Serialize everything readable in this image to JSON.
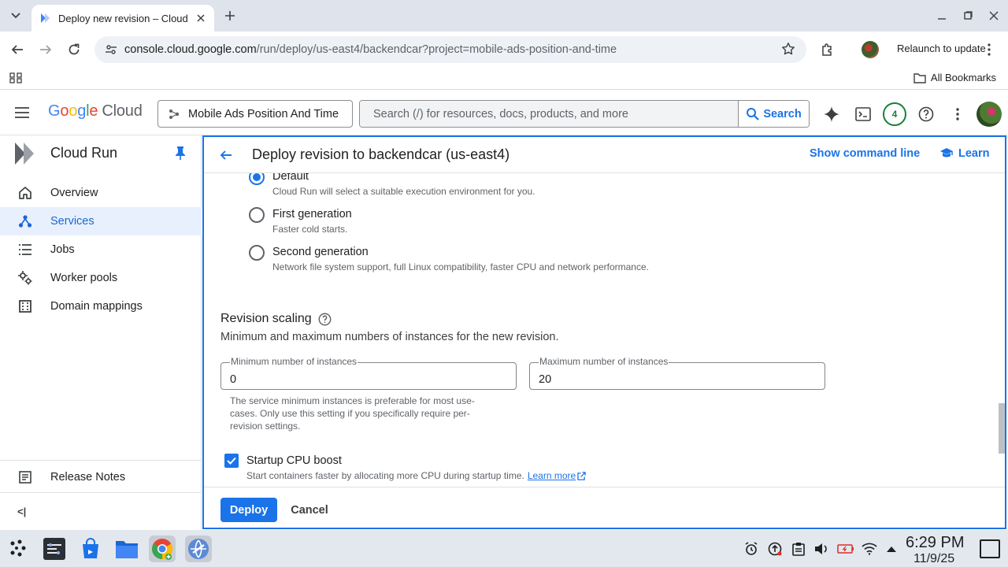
{
  "browser": {
    "tab_title": "Deploy new revision – Cloud",
    "url_host": "console.cloud.google.com",
    "url_path": "/run/deploy/us-east4/backendcar?project=mobile-ads-position-and-time",
    "relaunch_label": "Relaunch to update",
    "all_bookmarks_label": "All Bookmarks"
  },
  "header": {
    "logo_google": "Google",
    "logo_cloud": "Cloud",
    "project_name": "Mobile Ads Position And Time",
    "search_placeholder": "Search (/) for resources, docs, products, and more",
    "search_button": "Search",
    "notifications_count": "4"
  },
  "sidebar": {
    "title": "Cloud Run",
    "items": [
      {
        "label": "Overview",
        "icon": "home-icon"
      },
      {
        "label": "Services",
        "icon": "services-icon",
        "active": true
      },
      {
        "label": "Jobs",
        "icon": "list-icon"
      },
      {
        "label": "Worker pools",
        "icon": "gears-icon"
      },
      {
        "label": "Domain mappings",
        "icon": "building-icon"
      }
    ],
    "release_notes": "Release Notes",
    "collapse_label": "<|"
  },
  "page": {
    "title": "Deploy revision to backendcar (us-east4)",
    "show_command_line": "Show command line",
    "learn": "Learn",
    "execution_env": {
      "options": [
        {
          "label": "Default",
          "description": "Cloud Run will select a suitable execution environment for you.",
          "selected": true
        },
        {
          "label": "First generation",
          "description": "Faster cold starts.",
          "selected": false
        },
        {
          "label": "Second generation",
          "description": "Network file system support, full Linux compatibility, faster CPU and network performance.",
          "selected": false
        }
      ]
    },
    "revision_scaling": {
      "title": "Revision scaling",
      "description": "Minimum and maximum numbers of instances for the new revision.",
      "min_label": "Minimum number of instances",
      "min_value": "0",
      "max_label": "Maximum number of instances",
      "max_value": "20",
      "min_hint": "The service minimum instances is preferable for most use-cases. Only use this setting if you specifically require per-revision settings."
    },
    "startup_cpu_boost": {
      "label": "Startup CPU boost",
      "checked": true,
      "description": "Start containers faster by allocating more CPU during startup time.",
      "learn_more": "Learn more"
    },
    "deploy_button": "Deploy",
    "cancel_button": "Cancel"
  },
  "shelf": {
    "time": "6:29 PM",
    "date": "11/9/25"
  },
  "colors": {
    "accent": "#1a73e8",
    "active_nav_bg": "#e8f0fe",
    "notification_green": "#188038"
  }
}
